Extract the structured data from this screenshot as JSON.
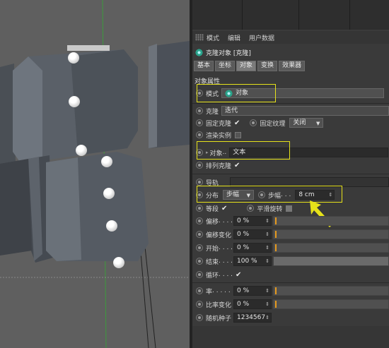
{
  "menubar": {
    "items": [
      "模式",
      "编辑",
      "用户数据"
    ]
  },
  "object": {
    "title": "克隆对象 [克隆]"
  },
  "tabs": [
    "基本",
    "坐标",
    "对象",
    "变换",
    "效果器"
  ],
  "active_tab": "对象",
  "section_title": "对象属性",
  "fields": {
    "mode_label": "模式",
    "mode_value": "对象",
    "clone_label": "克隆",
    "clone_value": "迭代",
    "fixed_clone_label": "固定克隆",
    "fixed_texture_label": "固定纹理",
    "fixed_texture_value": "关闭",
    "render_instance_label": "渲染实例",
    "object_label": "对象",
    "object_value": "文本",
    "arrange_label": "排列克隆",
    "guide_label": "导轨",
    "distribution_label": "分布",
    "distribution_value": "步幅",
    "step_label": "步幅",
    "step_value": "8 cm",
    "equal_label": "等段",
    "smooth_label": "平滑旋转",
    "offset_label": "偏移",
    "offset_value": "0 %",
    "offset_var_label": "偏移变化",
    "offset_var_value": "0 %",
    "start_label": "开始",
    "start_value": "0 %",
    "end_label": "结束",
    "end_value": "100 %",
    "loop_label": "循环",
    "rate_label": "率",
    "rate_value": "0 %",
    "rate_var_label": "比率变化",
    "rate_var_value": "0 %",
    "seed_label": "随机种子",
    "seed_value": "1234567"
  },
  "colors": {
    "highlight": "#e6e21a",
    "accent": "#e69a1e"
  }
}
